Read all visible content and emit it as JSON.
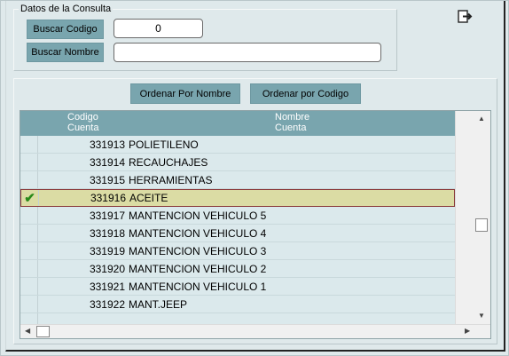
{
  "groupbox": {
    "title": "Datos de la Consulta",
    "buscar_codigo_label": "Buscar Codigo",
    "buscar_codigo_value": "0",
    "buscar_nombre_label": "Buscar Nombre",
    "buscar_nombre_value": ""
  },
  "toolbar": {
    "exit_icon": "exit-icon"
  },
  "order": {
    "by_name_label": "Ordenar Por Nombre",
    "by_code_label": "Ordenar por Codigo"
  },
  "grid": {
    "headers": {
      "codigo_line1": "Codigo",
      "codigo_line2": "Cuenta",
      "nombre_line1": "Nombre",
      "nombre_line2": "Cuenta"
    },
    "rows": [
      {
        "code": "331913",
        "name": "POLIETILENO",
        "selected": false
      },
      {
        "code": "331914",
        "name": "RECAUCHAJES",
        "selected": false
      },
      {
        "code": "331915",
        "name": "HERRAMIENTAS",
        "selected": false
      },
      {
        "code": "331916",
        "name": "ACEITE",
        "selected": true
      },
      {
        "code": "331917",
        "name": "MANTENCION VEHICULO 5",
        "selected": false
      },
      {
        "code": "331918",
        "name": "MANTENCION VEHICULO 4",
        "selected": false
      },
      {
        "code": "331919",
        "name": "MANTENCION VEHICULO 3",
        "selected": false
      },
      {
        "code": "331920",
        "name": "MANTENCION VEHICULO 2",
        "selected": false
      },
      {
        "code": "331921",
        "name": "MANTENCION VEHICULO 1",
        "selected": false
      },
      {
        "code": "331922",
        "name": "MANT.JEEP",
        "selected": false
      }
    ],
    "selected_marker": "✔"
  },
  "colors": {
    "accent": "#79a5ae",
    "row_bg": "#dbe9ec",
    "selected_bg": "#dbdca4",
    "check": "#2a8a1a"
  }
}
